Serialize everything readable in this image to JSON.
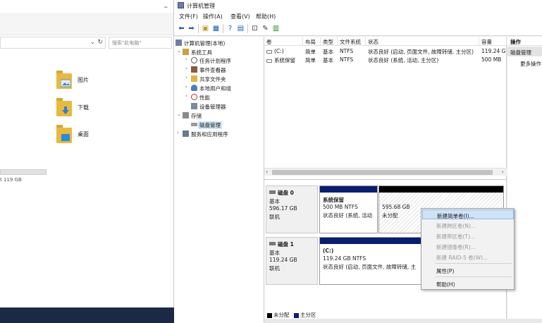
{
  "explorer": {
    "search_placeholder": "搜索\"此电脑\"",
    "folders": [
      {
        "label": "图片",
        "icon": "pictures-folder-icon"
      },
      {
        "label": "下载",
        "icon": "downloads-folder-icon"
      },
      {
        "label": "桌面",
        "icon": "desktop-folder-icon"
      }
    ],
    "drive_free_text": "t 119 GB"
  },
  "window": {
    "title": "计算机管理",
    "menu": [
      "文件(F)",
      "操作(A)",
      "查看(V)",
      "帮助(H)"
    ]
  },
  "tree": {
    "root": "计算机管理(本地)",
    "system_tools": "系统工具",
    "task_scheduler": "任务计划程序",
    "event_viewer": "事件查看器",
    "shared_folders": "共享文件夹",
    "local_users": "本地用户和组",
    "performance": "性能",
    "device_manager": "设备管理器",
    "storage": "存储",
    "disk_management": "磁盘管理",
    "services": "服务和应用程序"
  },
  "volume_list": {
    "columns": [
      "卷",
      "布局",
      "类型",
      "文件系统",
      "状态",
      "容量"
    ],
    "rows": [
      [
        "(C:)",
        "简单",
        "基本",
        "NTFS",
        "状态良好 (启动, 页面文件, 故障转储, 主分区)",
        "119.24 G"
      ],
      [
        "系统保留",
        "简单",
        "基本",
        "NTFS",
        "状态良好 (系统, 活动, 主分区)",
        "500 MB"
      ]
    ]
  },
  "disks": [
    {
      "name": "磁盘 0",
      "type": "基本",
      "size": "596.17 GB",
      "status": "联机",
      "partitions": [
        {
          "title": "系统保留",
          "line1": "500 MB NTFS",
          "line2": "状态良好 (系统, 活动"
        },
        {
          "title": "",
          "line1": "595.68 GB",
          "line2": "未分配"
        }
      ]
    },
    {
      "name": "磁盘 1",
      "type": "基本",
      "size": "119.24 GB",
      "status": "联机",
      "partitions": [
        {
          "title": "(C:)",
          "line1": "119.24 GB NTFS",
          "line2": "状态良好 (启动, 页面文件, 故障转储, 主"
        }
      ]
    }
  ],
  "legend": {
    "unallocated": "未分配",
    "primary": "主分区"
  },
  "actions": {
    "header": "操作",
    "section": "磁盘管理",
    "more": "更多操作"
  },
  "context_menu": {
    "items": [
      {
        "label": "新建简单卷(I)...",
        "enabled": true
      },
      {
        "label": "新建跨区卷(N)...",
        "enabled": false
      },
      {
        "label": "新建带区卷(T)...",
        "enabled": false
      },
      {
        "label": "新建镜像卷(R)...",
        "enabled": false
      },
      {
        "label": "新建 RAID-5 卷(W)...",
        "enabled": false
      },
      {
        "label": "属性(P)",
        "enabled": true
      },
      {
        "label": "帮助(H)",
        "enabled": true
      }
    ]
  },
  "colors": {
    "primary_partition": "#0a1e6e",
    "unallocated": "#000000",
    "selection": "#cce4f7"
  }
}
